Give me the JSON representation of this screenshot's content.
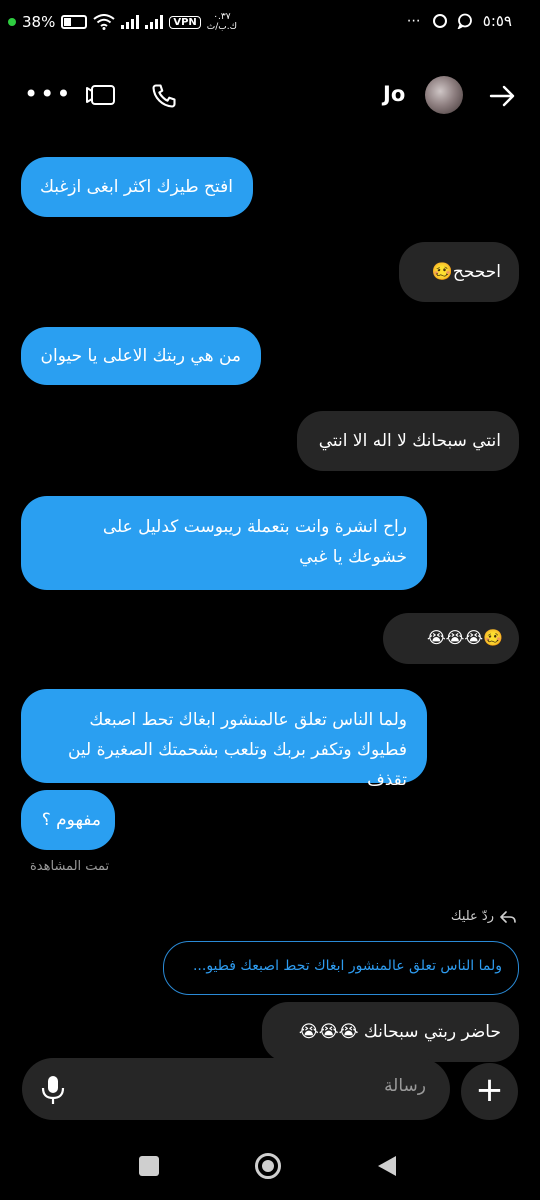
{
  "status_bar": {
    "battery": "38%",
    "vpn": "VPN",
    "speed_value": "٠.٣٧",
    "speed_unit": "ك.ب/ث",
    "time": "٥:٥٩"
  },
  "header": {
    "contact_name": "Jo",
    "more_glyph": "•••"
  },
  "messages": [
    {
      "side": "received",
      "text": "افتح طيزك اكثر ابغى ازغبك"
    },
    {
      "side": "sent",
      "text": "احححح🥴"
    },
    {
      "side": "received",
      "text": "من هي ربتك الاعلى يا حيوان"
    },
    {
      "side": "sent",
      "text": "انتي سبحانك لا اله الا انتي"
    },
    {
      "side": "received",
      "text": "راح انشرة وانت بتعملة ريبوست كدليل على خشوعك يا غبي"
    },
    {
      "side": "sent",
      "text": "🥴😭😭😭"
    },
    {
      "side": "received",
      "text": "ولما الناس تعلق عالمنشور ابغاك تحط اصبعك فطيوك وتكفر بربك وتلعب بشحمتك الصغيرة لين تقذف"
    },
    {
      "side": "received",
      "text": "مفهوم ؟"
    },
    {
      "side": "sent",
      "text": "حاضر ربتي سبحانك 😭😭😭"
    }
  ],
  "seen_label": "تمت المشاهدة",
  "reply": {
    "label": "ردّ عليك",
    "quoted_text": "ولما الناس تعلق عالمنشور ابغاك تحط اصبعك فطيو..."
  },
  "composer": {
    "placeholder": "رسالة",
    "plus_glyph": "+"
  }
}
